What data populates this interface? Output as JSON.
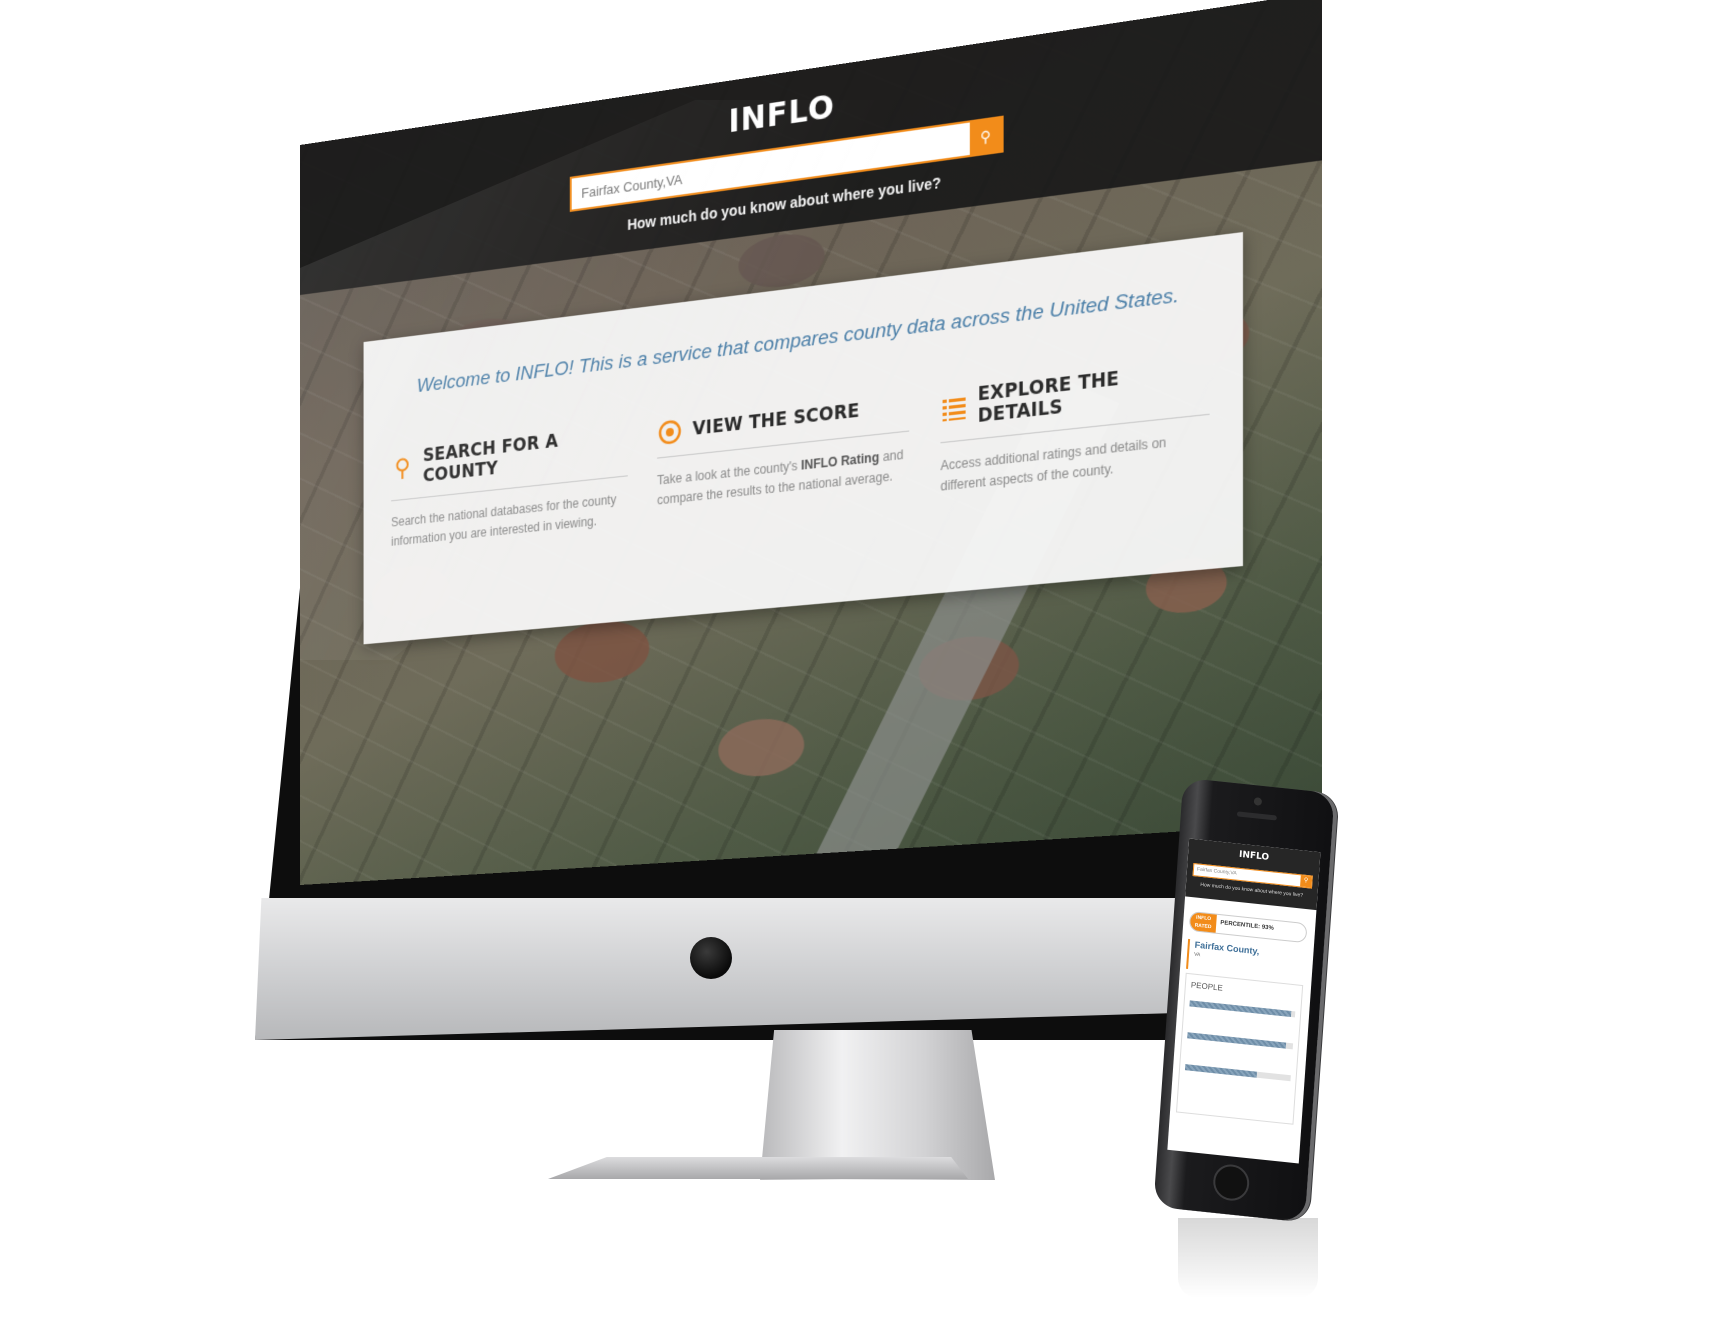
{
  "desktop": {
    "site": {
      "logo": "INFLO",
      "search": {
        "value": "Fairfax County,VA",
        "button_icon": "search-icon"
      },
      "tagline": "How much do you know about where you live?"
    },
    "welcome": {
      "text": "Welcome to INFLO! This is a service that compares county data across the United States.",
      "features": [
        {
          "icon": "search-icon",
          "title": "SEARCH FOR A COUNTY",
          "description": "Search the national databases for the county information you are interested in viewing."
        },
        {
          "icon": "eye-icon",
          "title": "VIEW THE SCORE",
          "description_pre": "Take a look at the county's ",
          "description_bold": "INFLO Rating",
          "description_post": " and compare the results to the national average."
        },
        {
          "icon": "list-icon",
          "title": "EXPLORE THE DETAILS",
          "description": "Access additional ratings and details on different aspects of the county."
        }
      ]
    }
  },
  "mobile": {
    "logo": "INFLO",
    "search_value": "Fairfax County,VA",
    "tagline": "How much do you know about where you live?",
    "badge": {
      "line1": "INFLO",
      "line2": "RATED",
      "percentile": "PERCENTILE: 93%"
    },
    "county": "Fairfax County,",
    "state": "VA",
    "section_title": "PEOPLE",
    "stats": [
      {
        "label": "",
        "fill": 0.96
      },
      {
        "label": "",
        "fill": 0.93
      },
      {
        "label": "",
        "fill": 0.68
      }
    ]
  },
  "colors": {
    "accent": "#f28c1a",
    "header_bg": "#262626",
    "welcome_text": "#4b7fa8",
    "county_text": "#3e6f98"
  }
}
